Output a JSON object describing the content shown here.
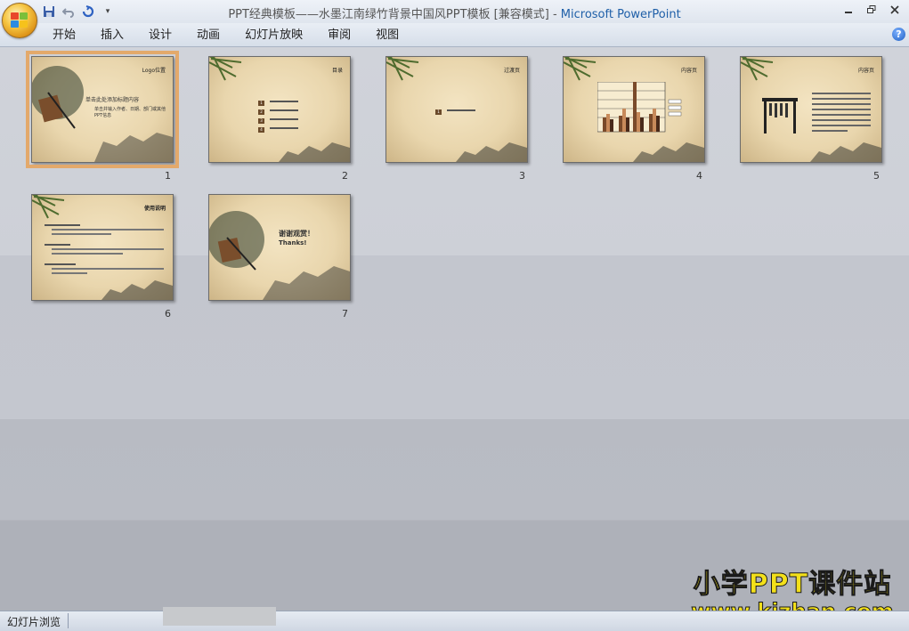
{
  "window": {
    "doc_title": "PPT经典模板——水墨江南绿竹背景中国风PPT模板 [兼容模式]",
    "separator": " - ",
    "app_name": "Microsoft PowerPoint",
    "controls": [
      "minimize-icon",
      "restore-icon",
      "close-icon"
    ]
  },
  "quick_access": [
    "save-icon",
    "undo-icon",
    "redo-icon",
    "customize-icon"
  ],
  "ribbon": {
    "tabs": [
      "开始",
      "插入",
      "设计",
      "动画",
      "幻灯片放映",
      "审阅",
      "视图"
    ],
    "help": "?"
  },
  "slides": [
    {
      "number": "1",
      "title": "Logo位置",
      "text1": "单击此处添加标题内容",
      "text2": "单击并输入作者、日期、部门或其他PPT信息"
    },
    {
      "number": "2",
      "title": "目录",
      "items": [
        "1",
        "2",
        "3",
        "4"
      ]
    },
    {
      "number": "3",
      "title": "过渡页",
      "items": [
        "1"
      ]
    },
    {
      "number": "4",
      "title": "内容页"
    },
    {
      "number": "5",
      "title": "内容页"
    },
    {
      "number": "6",
      "title": "使用说明"
    },
    {
      "number": "7",
      "text1": "谢谢观赏！",
      "text2": "Thanks!"
    }
  ],
  "status": {
    "view_label": "幻灯片浏览"
  },
  "watermark": {
    "line1": "小学PPT课件站",
    "line2": "www.kjzhan.com"
  },
  "colors": {
    "selected_outline": "#e3a96b",
    "app_name": "#1f5fa8"
  }
}
